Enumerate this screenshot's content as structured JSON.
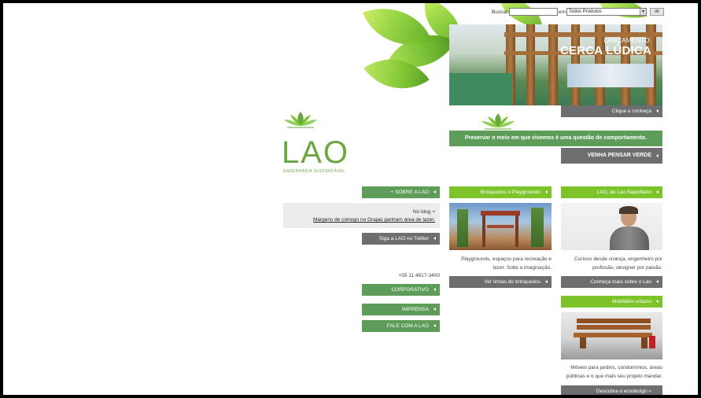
{
  "search": {
    "label": "Buscar",
    "in_label": "em",
    "query_value": "",
    "scope_value": "Todos Produtos",
    "submit_label": "ok"
  },
  "hero": {
    "title_line1": "LANÇAMENTO",
    "title_line2": "CERCA LÚDICA",
    "cta": "Clique e conheça"
  },
  "tagline": {
    "text": "Preservar o meio em que vivemos é uma questão de comportamento.",
    "cta": "VENHA PENSAR VERDE"
  },
  "logo": {
    "name": "LAO",
    "subtitle": "ENGENHARIA SUSTENTÁVEL"
  },
  "left_column": {
    "about_button": "+ SOBRE A LAO",
    "blog_title": "No blog +",
    "blog_link": "Margens de córrego no Grajaú ganham área de lazer.",
    "twitter_button": "Siga a LAO no Twitter",
    "phone": "+55 11 4617-3400",
    "corporate_button": "CORPORATIVO",
    "press_button": "IMPRENSA",
    "contact_button": "FALE COM A LAO"
  },
  "playgrounds": {
    "header": "Brinquedos e Playgrounds",
    "text": "Playgrounds, espaços para recreação e lazer. Solte a imaginação.",
    "cta": "Ver linhas de brinquedos"
  },
  "founder": {
    "header": "LAO, de Lao Napolitano",
    "text": "Curioso desde criança, engenheiro por profissão, designer por paixão.",
    "cta": "Conheça mais sobre o Lao"
  },
  "furniture": {
    "header": "Mobiliário urbano",
    "text": "Móveis para jardins, condomínios, áreas públicas e o que mais seu projeto mandar.",
    "cta": "Descubra o ecodesign «"
  },
  "colors": {
    "green": "#5d9c59",
    "lime": "#7cc42a",
    "dark_gray": "#6d6e70",
    "logo_green": "#6aa841"
  }
}
